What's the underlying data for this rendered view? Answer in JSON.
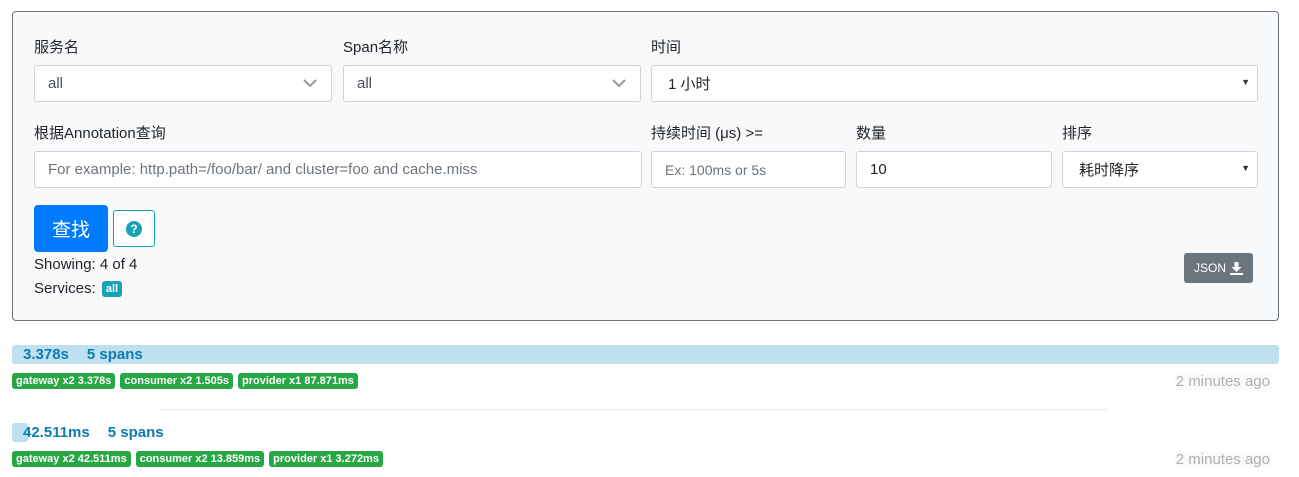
{
  "search": {
    "service_label": "服务名",
    "service_value": "all",
    "span_label": "Span名称",
    "span_value": "all",
    "time_label": "时间",
    "time_value": "1 小时",
    "annotation_label": "根据Annotation查询",
    "annotation_placeholder": "For example: http.path=/foo/bar/ and cluster=foo and cache.miss",
    "duration_label": "持续时间 (μs) >=",
    "duration_placeholder": "Ex: 100ms or 5s",
    "limit_label": "数量",
    "limit_value": "10",
    "sort_label": "排序",
    "sort_value": "耗时降序",
    "search_button": "查找",
    "help_icon": "?",
    "json_button": "JSON"
  },
  "summary": {
    "showing": "Showing: 4 of 4",
    "services_label": "Services:",
    "services_badge": "all"
  },
  "traces": [
    {
      "duration": "3.378s",
      "spans": "5 spans",
      "bar_fraction": 1.0,
      "tags": [
        "gateway x2 3.378s",
        "consumer x2 1.505s",
        "provider x1 87.871ms"
      ],
      "ago": "2 minutes ago"
    },
    {
      "duration": "42.511ms",
      "spans": "5 spans",
      "bar_fraction": 0.0126,
      "tags": [
        "gateway x2 42.511ms",
        "consumer x2 13.859ms",
        "provider x1 3.272ms"
      ],
      "ago": "2 minutes ago"
    }
  ],
  "colors": {
    "primary": "#007bff",
    "info": "#17a2b8",
    "success": "#28a745",
    "secondary": "#6c757d",
    "duration_bar": "#bee0ef",
    "duration_text": "#0e7bb3"
  },
  "icons": {
    "dropdown": "chevron-down-icon",
    "select": "caret-down-icon",
    "help": "question-circle-icon",
    "download": "download-icon"
  }
}
